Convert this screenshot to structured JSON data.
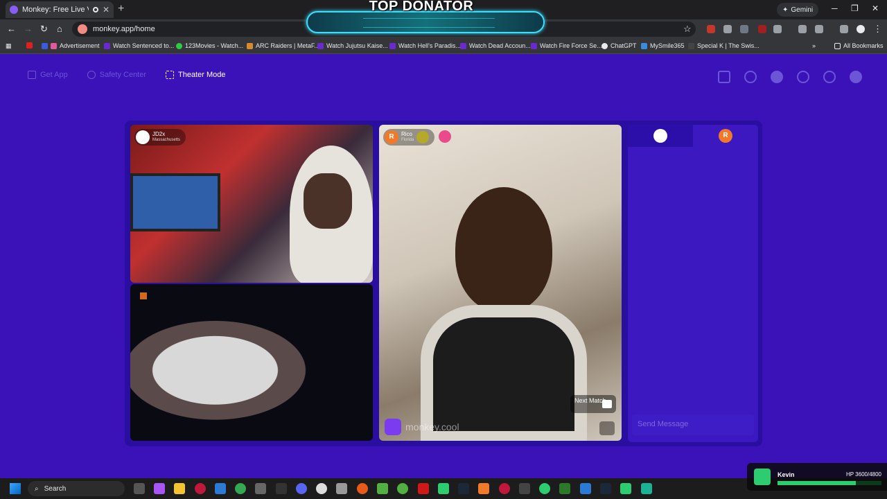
{
  "browser": {
    "tab_title": "Monkey: Free Live Video Ch",
    "tab_close": "✕",
    "new_tab": "+",
    "url": "monkey.app/home",
    "gemini_label": "Gemini",
    "win_min": "─",
    "win_max": "❐",
    "win_close": "✕"
  },
  "overlay": {
    "top_donator": "TOP DONATOR"
  },
  "bookmarks": {
    "items": [
      {
        "label": ""
      },
      {
        "label": "Advertisement"
      },
      {
        "label": "Watch Sentenced to..."
      },
      {
        "label": "123Movies - Watch..."
      },
      {
        "label": "ARC Raiders | MetaF..."
      },
      {
        "label": "Watch Jujutsu Kaise..."
      },
      {
        "label": "Watch Hell's Paradis..."
      },
      {
        "label": "Watch Dead Accoun..."
      },
      {
        "label": "Watch Fire Force Se..."
      },
      {
        "label": "ChatGPT"
      },
      {
        "label": "MySmile365"
      },
      {
        "label": "Special K | The Swis..."
      }
    ],
    "more": "»",
    "all_bookmarks": "All Bookmarks"
  },
  "topnav": {
    "get_app": "Get App",
    "safety_center": "Safety Center",
    "theater_mode": "Theater Mode"
  },
  "videos": {
    "v1_name": "JD2x",
    "v1_location": "Massachusetts",
    "v3_name": "Rico",
    "v3_location": "Florida",
    "v3_initial": "R",
    "next_match": "Next Match",
    "brand": "monkey.cool"
  },
  "chat": {
    "tab2_initial": "R",
    "placeholder": "Send Message"
  },
  "taskbar": {
    "search": "Search"
  },
  "overlay_player": {
    "name": "Kevin",
    "hp_text": "HP 3600/4800",
    "hp_fraction": 0.75
  },
  "colors": {
    "page_bg": "#3b12b8",
    "panel_bg": "#2a0ea0",
    "accent": "#7b3cf0",
    "hp_green": "#2ecc71"
  }
}
